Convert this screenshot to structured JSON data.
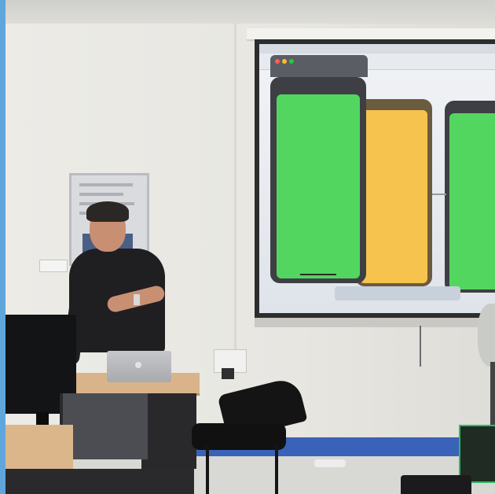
{
  "image": {
    "content_labels": []
  },
  "palette": {
    "wall": "#ecebe6",
    "screen_green": "#53d65f",
    "screen_yellow": "#f6c44e",
    "floor_blue": "#3a62b8",
    "edge_blue": "#5fa6dc"
  }
}
